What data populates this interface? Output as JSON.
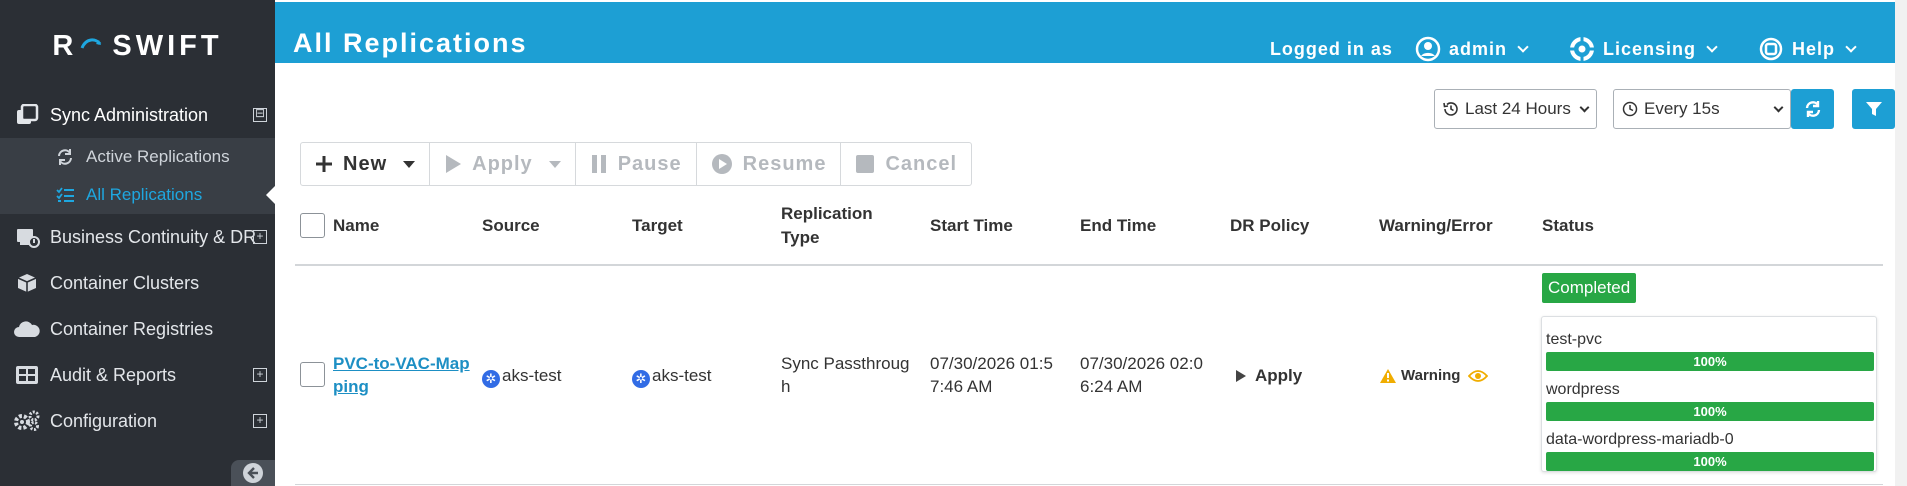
{
  "brand": {
    "logo_mark": "R",
    "name": "SWIFT"
  },
  "sidebar": {
    "sections": [
      {
        "label": "Sync Administration",
        "icon": "copy-icon",
        "expand": "⊟",
        "children": [
          {
            "label": "Active Replications",
            "icon": "sync-icon"
          },
          {
            "label": "All Replications",
            "icon": "list-check-icon"
          }
        ]
      },
      {
        "label": "Business Continuity & DR",
        "icon": "disaster-recovery-icon",
        "expand": "+"
      },
      {
        "label": "Container Clusters",
        "icon": "cube-icon"
      },
      {
        "label": "Container Registries",
        "icon": "cloud-icon"
      },
      {
        "label": "Audit & Reports",
        "icon": "grid-icon",
        "expand": "+"
      },
      {
        "label": "Configuration",
        "icon": "gears-icon",
        "expand": "+"
      }
    ]
  },
  "header": {
    "title": "All Replications",
    "logged_in_label": "Logged in as",
    "user": "admin",
    "licensing": "Licensing",
    "help": "Help",
    "bg_color": "#1d9fd4"
  },
  "filters": {
    "time_range": "Last 24 Hours",
    "refresh_interval": "Every 15s"
  },
  "toolbar": {
    "new": "New",
    "apply": "Apply",
    "pause": "Pause",
    "resume": "Resume",
    "cancel": "Cancel"
  },
  "table": {
    "columns": {
      "name": "Name",
      "source": "Source",
      "target": "Target",
      "replication_type_1": "Replication",
      "replication_type_2": "Type",
      "start_time": "Start Time",
      "end_time": "End Time",
      "dr_policy": "DR Policy",
      "warning_error": "Warning/Error",
      "status": "Status"
    },
    "rows": [
      {
        "name_line1": "PVC-to-VAC-Map",
        "name_line2": "ping",
        "source": "aks-test",
        "target": "aks-test",
        "type_line1": "Sync Passthroug",
        "type_line2": "h",
        "start_line1": "07/30/2026 01:5",
        "start_line2": "7:46 AM",
        "end_line1": "07/30/2026 02:0",
        "end_line2": "6:24 AM",
        "dr_policy": "Apply",
        "warning": "Warning",
        "status": "Completed",
        "pvcs": [
          {
            "name": "test-pvc",
            "percent_label": "100%",
            "progress": 100
          },
          {
            "name": "wordpress",
            "percent_label": "100%",
            "progress": 100
          },
          {
            "name": "data-wordpress-mariadb-0",
            "percent_label": "100%",
            "progress": 100
          }
        ]
      }
    ]
  },
  "colors": {
    "success": "#28a745",
    "warning": "#f0ad00",
    "link": "#1d8fc4",
    "sidebar_bg": "#2b2f35"
  }
}
